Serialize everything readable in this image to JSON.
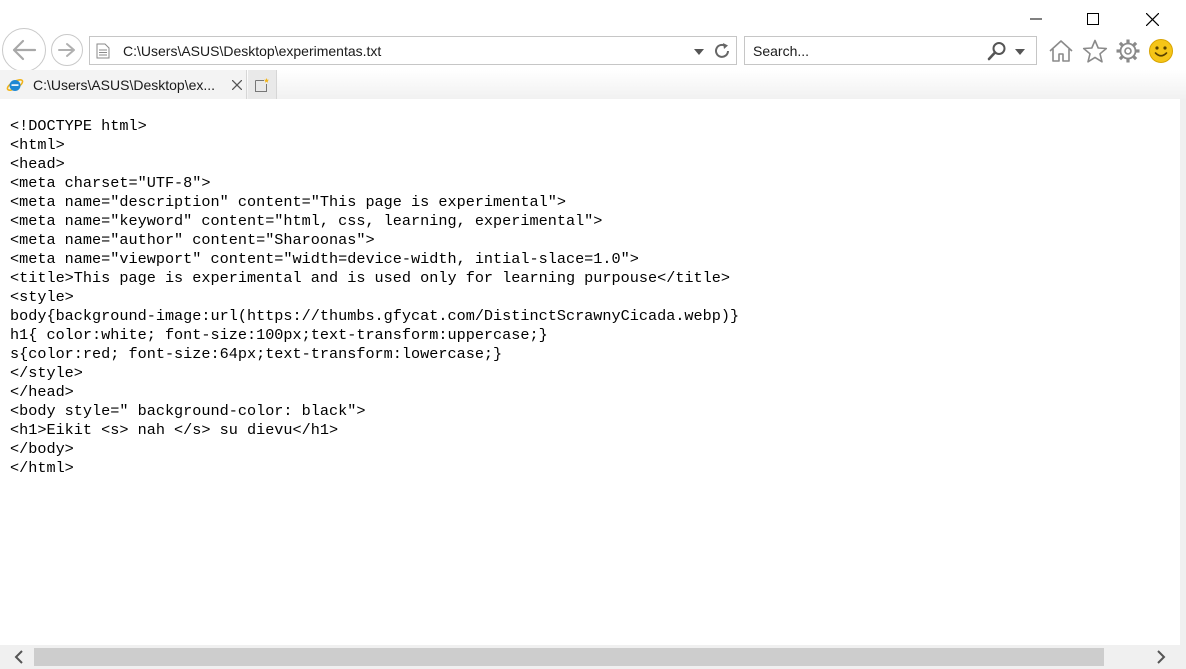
{
  "window": {
    "minimize_icon": "minimize-icon",
    "maximize_icon": "maximize-icon",
    "close_icon": "close-icon"
  },
  "nav": {
    "back_icon": "back-arrow-icon",
    "forward_icon": "forward-arrow-icon",
    "address": "C:\\Users\\ASUS\\Desktop\\experimentas.txt",
    "search_placeholder": "Search..."
  },
  "toolbar": {
    "icons": [
      "home-icon",
      "favorites-star-icon",
      "settings-gear-icon",
      "feedback-smiley-icon"
    ]
  },
  "tabs": [
    {
      "label": "C:\\Users\\ASUS\\Desktop\\ex...",
      "active": true
    }
  ],
  "document": {
    "lines": [
      "<!DOCTYPE html>",
      "<html>",
      "<head>",
      "<meta charset=\"UTF-8\">",
      "<meta name=\"description\" content=\"This page is experimental\">",
      "<meta name=\"keyword\" content=\"html, css, learning, experimental\">",
      "<meta name=\"author\" content=\"Sharoonas\">",
      "<meta name=\"viewport\" content=\"width=device-width, intial-slace=1.0\">",
      "<title>This page is experimental and is used only for learning purpouse</title>",
      "<style>",
      "body{background-image:url(https://thumbs.gfycat.com/DistinctScrawnyCicada.webp)}",
      "h1{ color:white; font-size:100px;text-transform:uppercase;}",
      "s{color:red; font-size:64px;text-transform:lowercase;}",
      "</style>",
      "</head>",
      "<body style=\" background-color: black\">",
      "<h1>Eikit <s> nah </s> su dievu</h1>",
      "</body>",
      "</html>"
    ]
  },
  "colors": {
    "ie_blue": "#1e88d3",
    "smiley_yellow": "#f5c518",
    "icon_gray": "#8a8a8a"
  }
}
